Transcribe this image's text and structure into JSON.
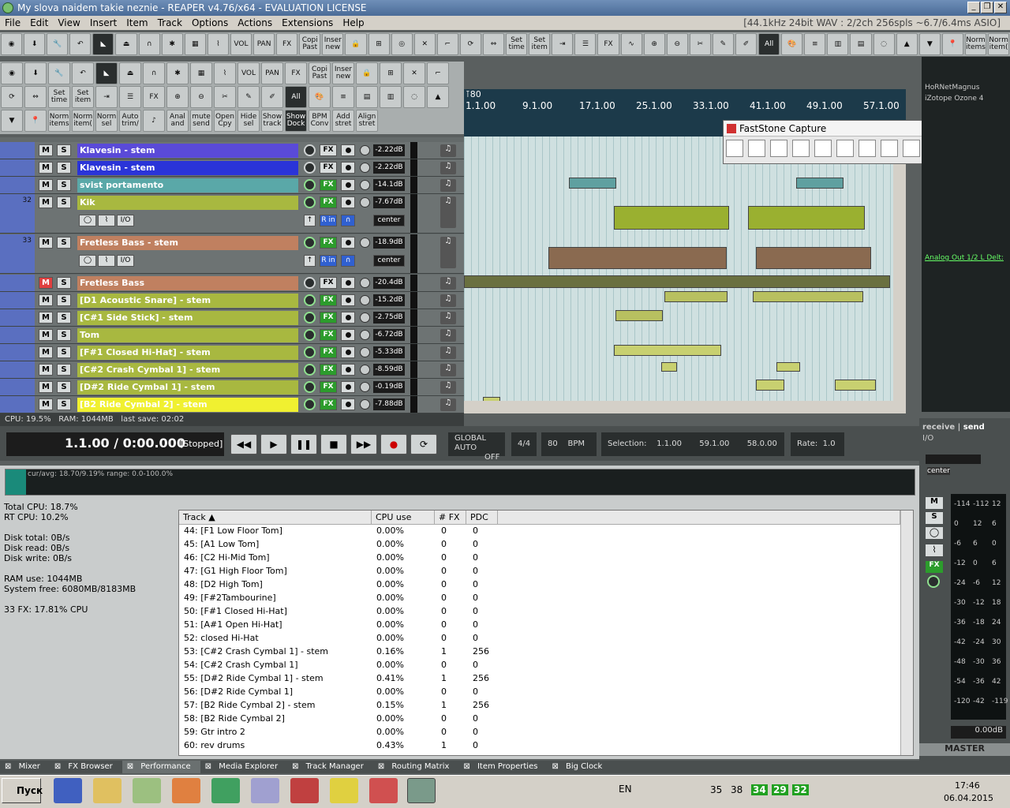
{
  "window": {
    "title": "My slova naidem takie neznie - REAPER v4.76/x64 - EVALUATION LICENSE",
    "audio_info": "[44.1kHz 24bit WAV : 2/2ch 256spls ~6.7/6.4ms ASIO]"
  },
  "menu": [
    "File",
    "Edit",
    "View",
    "Insert",
    "Item",
    "Track",
    "Options",
    "Actions",
    "Extensions",
    "Help"
  ],
  "toolbar": {
    "labels": [
      "Copi Past",
      "Inser new",
      "Set time",
      "Set item",
      "Norm items",
      "Norm item(",
      "All"
    ]
  },
  "left_toolbar": {
    "labels": [
      "Copi Past",
      "Inser new",
      "Set time",
      "Set item",
      "Norm items",
      "Norm item(",
      "Norm sel",
      "Auto trim/",
      "Anal and",
      "mute send",
      "Open Cpy",
      "Hide sel",
      "Show track",
      "Show Dock",
      "BPM Conv",
      "Add stret",
      "Align stret",
      "All"
    ]
  },
  "tracks": [
    {
      "num": "",
      "name": "Klavesin - stem",
      "color": "#5a4ad8",
      "vol": "-2.22dB",
      "mute": false,
      "fx_on": false
    },
    {
      "num": "",
      "name": "Klavesin - stem",
      "color": "#2a34d8",
      "vol": "-2.22dB",
      "mute": false,
      "fx_on": false
    },
    {
      "num": "",
      "name": "svist portamento",
      "color": "#5aa8a8",
      "vol": "-14.1dB",
      "mute": false,
      "fx_on": true
    },
    {
      "num": "32",
      "name": "Kik",
      "color": "#a8b840",
      "vol": "-7.67dB",
      "mute": false,
      "fx_on": true,
      "pan": "center"
    },
    {
      "num": "33",
      "name": "Fretless Bass - stem",
      "color": "#c08060",
      "vol": "-18.9dB",
      "mute": false,
      "fx_on": true,
      "pan": "center"
    },
    {
      "num": "",
      "name": "Fretless Bass",
      "color": "#c08060",
      "vol": "-20.4dB",
      "mute": true,
      "fx_on": false
    },
    {
      "num": "",
      "name": "[D1 Acoustic Snare] - stem",
      "color": "#a8b840",
      "vol": "-15.2dB",
      "mute": false,
      "fx_on": true
    },
    {
      "num": "",
      "name": "[C#1 Side Stick] - stem",
      "color": "#a8b840",
      "vol": "-2.75dB",
      "mute": false,
      "fx_on": true
    },
    {
      "num": "",
      "name": "Tom",
      "color": "#a8b840",
      "vol": "-6.72dB",
      "mute": false,
      "fx_on": true
    },
    {
      "num": "",
      "name": "[F#1 Closed Hi-Hat] - stem",
      "color": "#a8b840",
      "vol": "-5.33dB",
      "mute": false,
      "fx_on": true
    },
    {
      "num": "",
      "name": "[C#2 Crash Cymbal 1] - stem",
      "color": "#a8b840",
      "vol": "-8.59dB",
      "mute": false,
      "fx_on": true
    },
    {
      "num": "",
      "name": "[D#2 Ride Cymbal 1] - stem",
      "color": "#a8b840",
      "vol": "-0.19dB",
      "mute": false,
      "fx_on": true
    },
    {
      "num": "",
      "name": "[B2 Ride Cymbal 2] - stem",
      "color": "#f0f030",
      "vol": "-7.88dB",
      "mute": false,
      "fx_on": true
    }
  ],
  "track_controls": {
    "mute": "M",
    "solo": "S",
    "fx": "FX",
    "io": "I/O",
    "r_in": "R in"
  },
  "ruler": {
    "marker": "80",
    "ticks": [
      "1.1.00",
      "9.1.00",
      "17.1.00",
      "25.1.00",
      "33.1.00",
      "41.1.00",
      "49.1.00",
      "57.1.00"
    ]
  },
  "faststone": {
    "title": "FastStone Capture"
  },
  "right_panel": {
    "fx1": "HoRNetMagnus",
    "fx2": "iZotope Ozone 4",
    "route": "Analog Out 1/2 L Delt:"
  },
  "status": {
    "cpu": "CPU: 19.5%",
    "ram": "RAM: 1044MB",
    "save": "last save: 02:02"
  },
  "transport": {
    "position": "1.1.00 / 0:00.000",
    "state": "[Stopped]",
    "global_auto": "GLOBAL AUTO",
    "auto_state": "OFF",
    "timesig": "4/4",
    "bpm": "80",
    "bpm_label": "BPM",
    "selection_label": "Selection:",
    "sel_start": "1.1.00",
    "sel_end": "59.1.00",
    "sel_len": "58.0.00",
    "rate_label": "Rate:",
    "rate": "1.0"
  },
  "performance": {
    "graph_label": "cur/avg: 18.70/9.19%  range: 0.0-100.0%",
    "stats": [
      "Total CPU: 18.7%",
      "RT CPU: 10.2%",
      "",
      "Disk total: 0B/s",
      "Disk read: 0B/s",
      "Disk write: 0B/s",
      "",
      "RAM use: 1044MB",
      "System free: 6080MB/8183MB",
      "",
      "33 FX: 17.81% CPU"
    ],
    "columns": [
      "Track",
      "CPU use",
      "# FX",
      "PDC"
    ],
    "rows": [
      [
        "44: [F1 Low Floor Tom]",
        "0.00%",
        "0",
        "0"
      ],
      [
        "45: [A1 Low Tom]",
        "0.00%",
        "0",
        "0"
      ],
      [
        "46: [C2 Hi-Mid Tom]",
        "0.00%",
        "0",
        "0"
      ],
      [
        "47: [G1 High Floor Tom]",
        "0.00%",
        "0",
        "0"
      ],
      [
        "48: [D2 High Tom]",
        "0.00%",
        "0",
        "0"
      ],
      [
        "49: [F#2Tambourine]",
        "0.00%",
        "0",
        "0"
      ],
      [
        "50: [F#1 Closed Hi-Hat]",
        "0.00%",
        "0",
        "0"
      ],
      [
        "51: [A#1 Open Hi-Hat]",
        "0.00%",
        "0",
        "0"
      ],
      [
        "52: closed Hi-Hat",
        "0.00%",
        "0",
        "0"
      ],
      [
        "53: [C#2 Crash Cymbal 1] - stem",
        "0.16%",
        "1",
        "256"
      ],
      [
        "54: [C#2 Crash Cymbal 1]",
        "0.00%",
        "0",
        "0"
      ],
      [
        "55: [D#2 Ride Cymbal 1] - stem",
        "0.41%",
        "1",
        "256"
      ],
      [
        "56: [D#2 Ride Cymbal 1]",
        "0.00%",
        "0",
        "0"
      ],
      [
        "57: [B2 Ride Cymbal 2] - stem",
        "0.15%",
        "1",
        "256"
      ],
      [
        "58: [B2 Ride Cymbal 2]",
        "0.00%",
        "0",
        "0"
      ],
      [
        "59: Gtr intro 2",
        "0.00%",
        "0",
        "0"
      ],
      [
        "60: rev drums",
        "0.43%",
        "1",
        "0"
      ]
    ]
  },
  "dock_tabs": [
    "Mixer",
    "FX Browser",
    "Performance",
    "Media Explorer",
    "Track Manager",
    "Routing Matrix",
    "Item Properties",
    "Big Clock"
  ],
  "mixer": {
    "receive": "receive",
    "send": "send",
    "io": "I/O",
    "pan": "center",
    "master": "MASTER",
    "vol": "0.00dB",
    "scale": [
      "-114",
      "-112",
      "12",
      "0",
      "12",
      "6",
      "-6",
      "6",
      "0",
      "-12",
      "0",
      "6",
      "-24",
      "-6",
      "12",
      "-30",
      "-12",
      "18",
      "-36",
      "-18",
      "24",
      "-42",
      "-24",
      "30",
      "-48",
      "-30",
      "36",
      "-54",
      "-36",
      "42",
      "-120",
      "-42",
      "-119"
    ]
  },
  "taskbar": {
    "start": "Пуск",
    "lang": "EN",
    "tray_nums": [
      "35",
      "38",
      "34",
      "29",
      "32"
    ],
    "time": "17:46",
    "date": "06.04.2015"
  }
}
